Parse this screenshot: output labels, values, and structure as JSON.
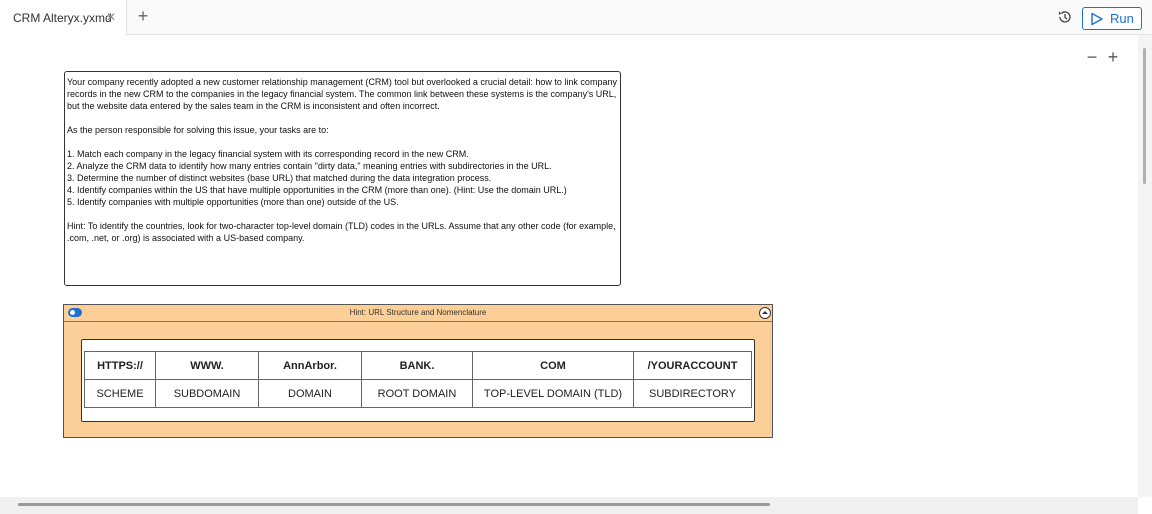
{
  "tab": {
    "title": "CRM Alteryx.yxmd",
    "close": "✕"
  },
  "toolbar": {
    "run_label": "Run"
  },
  "zoom": {
    "out": "−",
    "in": "+"
  },
  "description": {
    "para1": "Your company recently adopted a new customer relationship management (CRM) tool but overlooked a crucial detail: how to link company records in the new CRM to the companies in the legacy financial system. The common link between these systems is the company's URL, but the website data entered by the sales team in the CRM is inconsistent and often incorrect.",
    "para2": "As the person responsible for solving this issue, your tasks are to:",
    "tasks": [
      "1. Match each company in the legacy financial system with its corresponding record in the new CRM.",
      "2. Analyze the CRM data to identify how many entries contain \"dirty data,\" meaning entries with subdirectories in the URL.",
      "3. Determine the number of distinct websites (base URL) that matched during the data integration process.",
      "4. Identify companies within the US that have multiple opportunities in the CRM (more than one). (Hint: Use the domain URL.)",
      "5. Identify companies with multiple opportunities (more than one) outside of the US."
    ],
    "hint": "Hint: To identify the countries, look for two-character top-level domain (TLD) codes in the URLs. Assume that any other code (for example, .com, .net, or .org) is associated with a US-based company."
  },
  "hint_container": {
    "title": "Hint: URL Structure and Nomenclature",
    "parts": [
      "HTTPS://",
      "WWW.",
      "AnnArbor.",
      "BANK.",
      "COM",
      "/YOURACCOUNT"
    ],
    "names": [
      "SCHEME",
      "SUBDOMAIN",
      "DOMAIN",
      "ROOT DOMAIN",
      "TOP-LEVEL DOMAIN (TLD)",
      "SUBDIRECTORY"
    ],
    "fill_color": "#fdcf98"
  },
  "colors": {
    "accent": "#1e6fd6"
  }
}
